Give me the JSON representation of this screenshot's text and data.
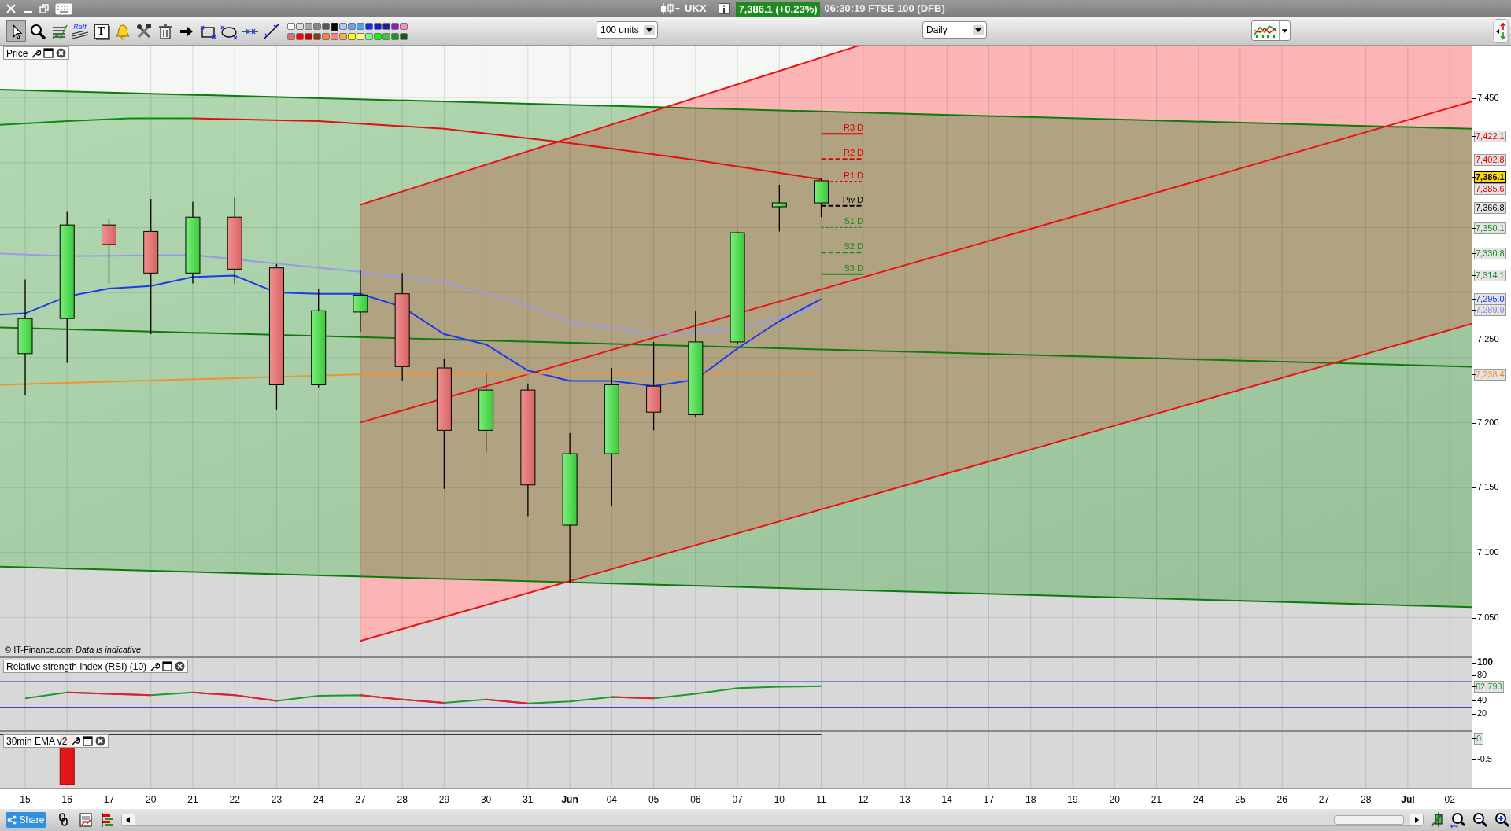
{
  "title_bar": {
    "symbol": "UKX",
    "price_badge": "7,386.1 (+0.23%)",
    "info": "06:30:19 FTSE 100 (DFB)"
  },
  "toolbar": {
    "tools": [
      {
        "kind": "pointer",
        "selected": true
      },
      {
        "kind": "zoom",
        "selected": false
      },
      {
        "kind": "fib",
        "selected": false
      },
      {
        "kind": "raff",
        "label": "Raff",
        "selected": false
      },
      {
        "kind": "text",
        "label": "T",
        "selected": false
      },
      {
        "kind": "alert",
        "selected": false
      },
      {
        "kind": "tools",
        "selected": false
      },
      {
        "kind": "trash",
        "selected": false
      },
      {
        "kind": "arrow",
        "selected": false
      },
      {
        "kind": "rectangle",
        "selected": false
      },
      {
        "kind": "ellipse",
        "selected": false
      },
      {
        "kind": "hline",
        "selected": false
      },
      {
        "kind": "line",
        "selected": false
      }
    ],
    "palette": [
      {
        "color": "#ffffff",
        "selected": false
      },
      {
        "color": "#dddddd",
        "selected": false
      },
      {
        "color": "#aaaaaa",
        "selected": false
      },
      {
        "color": "#888888",
        "selected": false
      },
      {
        "color": "#555555",
        "selected": false
      },
      {
        "color": "#000000",
        "selected": true
      },
      {
        "color": "#a8c8ff",
        "selected": false
      },
      {
        "color": "#6f9cff",
        "selected": false
      },
      {
        "color": "#40a8ff",
        "selected": false
      },
      {
        "color": "#0a2cff",
        "selected": false
      },
      {
        "color": "#1a1adb",
        "selected": false
      },
      {
        "color": "#1c1c99",
        "selected": false
      },
      {
        "color": "#8a1fb2",
        "selected": false
      },
      {
        "color": "#ff88cc",
        "selected": false
      },
      {
        "color": "#e07070",
        "selected": false
      },
      {
        "color": "#ff0000",
        "selected": false
      },
      {
        "color": "#cc0000",
        "selected": false
      },
      {
        "color": "#8b3a10",
        "selected": false
      },
      {
        "color": "#ff8040",
        "selected": false
      },
      {
        "color": "#ff8080",
        "selected": false
      },
      {
        "color": "#ffb030",
        "selected": false
      },
      {
        "color": "#ffff00",
        "selected": false
      },
      {
        "color": "#ffff80",
        "selected": false
      },
      {
        "color": "#80ff80",
        "selected": false
      },
      {
        "color": "#00ff00",
        "selected": false
      },
      {
        "color": "#40c040",
        "selected": false
      },
      {
        "color": "#209020",
        "selected": false
      },
      {
        "color": "#106010",
        "selected": false
      }
    ],
    "size_select": "100 units",
    "period_select": "Daily"
  },
  "price_panel": {
    "title": "Price",
    "credit": "© IT-Finance.com *Data is indicative*",
    "axis_labels": [
      "7,450",
      "7,250",
      "7,200",
      "7,150",
      "7,100",
      "7,050"
    ],
    "pivots": [
      {
        "label": "R3 D",
        "color": "#e00000",
        "kind": "solid"
      },
      {
        "label": "R2 D",
        "color": "#e00000",
        "kind": "dashed"
      },
      {
        "label": "R1 D",
        "color": "#e00000",
        "kind": "dotted"
      },
      {
        "label": "Piv D",
        "color": "#000000",
        "kind": "dashed"
      },
      {
        "label": "S1 D",
        "color": "#1a8a1a",
        "kind": "dotted"
      },
      {
        "label": "S2 D",
        "color": "#1a8a1a",
        "kind": "dashed"
      },
      {
        "label": "S3 D",
        "color": "#1a8a1a",
        "kind": "solid"
      }
    ],
    "price_markers": [
      {
        "text": "7,422.1",
        "color": "#e00000",
        "kind": "marker"
      },
      {
        "text": "7,402.8",
        "color": "#e00000",
        "kind": "marker"
      },
      {
        "text": "7,386.1",
        "color": "#000000",
        "kind": "current"
      },
      {
        "text": "7,385.6",
        "color": "#e00000",
        "kind": "marker"
      },
      {
        "text": "7,366.8",
        "color": "#000000",
        "kind": "marker"
      },
      {
        "text": "7,350.1",
        "color": "#1a8a1a",
        "kind": "marker"
      },
      {
        "text": "7,330.8",
        "color": "#1a8a1a",
        "kind": "marker"
      },
      {
        "text": "7,314.1",
        "color": "#1a8a1a",
        "kind": "marker"
      },
      {
        "text": "7,295.0",
        "color": "#1030ff",
        "kind": "marker"
      },
      {
        "text": "7,289.9",
        "color": "#8a8ae0",
        "kind": "marker"
      },
      {
        "text": "7,238.4",
        "color": "#f08a20",
        "kind": "marker"
      }
    ]
  },
  "rsi_panel": {
    "title": "Relative strength index (RSI) (10)",
    "reading": "62.793",
    "axis_labels": [
      "100",
      "80",
      "40",
      "20"
    ]
  },
  "ema_panel": {
    "title": "30min EMA v2",
    "reading": "0",
    "axis_label": "-0.5"
  },
  "date_axis": [
    {
      "text": "15",
      "kind": "day"
    },
    {
      "text": "16",
      "kind": "day"
    },
    {
      "text": "17",
      "kind": "day"
    },
    {
      "text": "20",
      "kind": "day"
    },
    {
      "text": "21",
      "kind": "day"
    },
    {
      "text": "22",
      "kind": "day"
    },
    {
      "text": "23",
      "kind": "day"
    },
    {
      "text": "24",
      "kind": "day"
    },
    {
      "text": "27",
      "kind": "day"
    },
    {
      "text": "28",
      "kind": "day"
    },
    {
      "text": "29",
      "kind": "day"
    },
    {
      "text": "30",
      "kind": "day"
    },
    {
      "text": "31",
      "kind": "day"
    },
    {
      "text": "Jun",
      "kind": "month"
    },
    {
      "text": "04",
      "kind": "day"
    },
    {
      "text": "05",
      "kind": "day"
    },
    {
      "text": "06",
      "kind": "day"
    },
    {
      "text": "07",
      "kind": "day"
    },
    {
      "text": "10",
      "kind": "day"
    },
    {
      "text": "11",
      "kind": "day"
    },
    {
      "text": "12",
      "kind": "day"
    },
    {
      "text": "13",
      "kind": "day"
    },
    {
      "text": "14",
      "kind": "day"
    },
    {
      "text": "17",
      "kind": "day"
    },
    {
      "text": "18",
      "kind": "day"
    },
    {
      "text": "19",
      "kind": "day"
    },
    {
      "text": "20",
      "kind": "day"
    },
    {
      "text": "21",
      "kind": "day"
    },
    {
      "text": "24",
      "kind": "day"
    },
    {
      "text": "25",
      "kind": "day"
    },
    {
      "text": "26",
      "kind": "day"
    },
    {
      "text": "27",
      "kind": "day"
    },
    {
      "text": "28",
      "kind": "day"
    },
    {
      "text": "Jul",
      "kind": "month"
    },
    {
      "text": "02",
      "kind": "day"
    }
  ],
  "bottom_bar": {
    "share_button": "Share"
  }
}
